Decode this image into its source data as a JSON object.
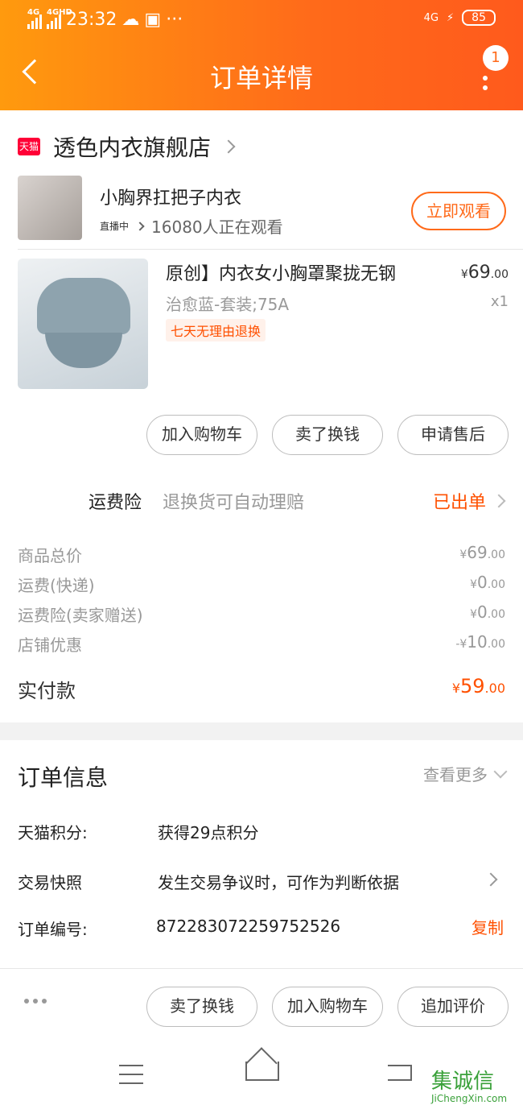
{
  "status": {
    "signal1": "4G",
    "signal2": "4GHD",
    "time": "23:32",
    "more": "···",
    "net": "4G",
    "battery": "85"
  },
  "header": {
    "title": "订单详情",
    "badge": "1"
  },
  "shop": {
    "logo": "天猫",
    "name": "透色内衣旗舰店"
  },
  "live": {
    "title": "小胸界扛把子内衣",
    "tag": "直播中",
    "viewers": "16080人正在观看",
    "button": "立即观看"
  },
  "product": {
    "title": "原创】内衣女小胸罩聚拢无钢",
    "sku": "治愈蓝-套装;75A",
    "tag": "七天无理由退换",
    "price_symbol": "¥",
    "price_int": "69",
    "price_dec": ".00",
    "qty": "x1"
  },
  "actions": [
    "加入购物车",
    "卖了换钱",
    "申请售后"
  ],
  "insurance": {
    "label": "运费险",
    "desc": "退换货可自动理赔",
    "status": "已出单"
  },
  "costs": [
    {
      "label": "商品总价",
      "symbol": "¥",
      "int": "69",
      "dec": ".00"
    },
    {
      "label": "运费(快递)",
      "symbol": "¥",
      "int": "0",
      "dec": ".00"
    },
    {
      "label": "运费险(卖家赠送)",
      "symbol": "¥",
      "int": "0",
      "dec": ".00"
    },
    {
      "label": "店铺优惠",
      "symbol": "-¥",
      "int": "10",
      "dec": ".00"
    }
  ],
  "paid": {
    "label": "实付款",
    "symbol": "¥",
    "int": "59",
    "dec": ".00"
  },
  "order_info": {
    "title": "订单信息",
    "view_more": "查看更多",
    "points_label": "天猫积分:",
    "points_value": "获得29点积分",
    "snapshot_label": "交易快照",
    "snapshot_value": "发生交易争议时，可作为判断依据",
    "order_no_label": "订单编号:",
    "order_no": "872283072259752526",
    "copy": "复制"
  },
  "bottom_actions": [
    "卖了换钱",
    "加入购物车",
    "追加评价"
  ],
  "watermark": "JiChengXin.com",
  "watermark_glyphs": "集诚信"
}
